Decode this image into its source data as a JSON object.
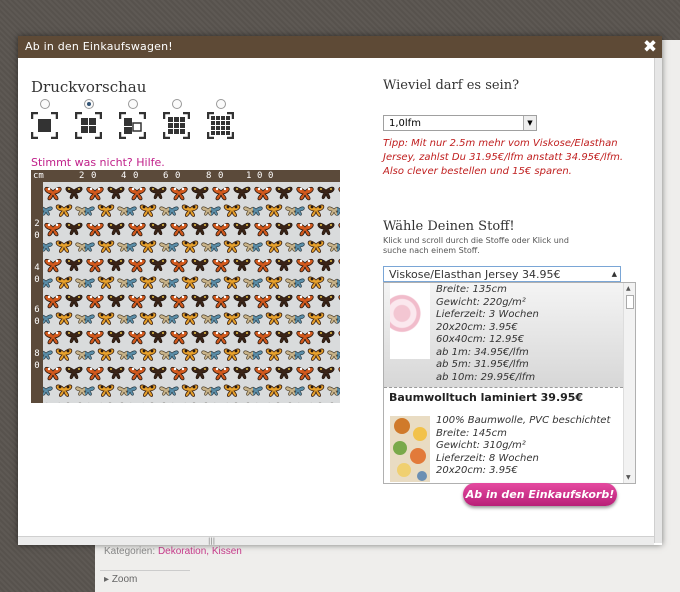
{
  "background": {
    "categories_label": "Kategorien:",
    "categories_links": "Dekoration, Kissen",
    "zoom_label": "Zoom"
  },
  "dialog": {
    "title": "Ab in den Einkaufswagen!",
    "close_icon": "close-icon"
  },
  "preview": {
    "heading": "Druckvorschau",
    "layout_options": [
      "single",
      "2x2",
      "offset",
      "3x3",
      "4x4"
    ],
    "selected_layout_index": 1,
    "help_link": "Stimmt was nicht? Hilfe.",
    "ruler_unit": "cm",
    "ruler_top_labels": [
      "2",
      "0",
      "4",
      "0",
      "6",
      "0",
      "8",
      "0",
      "1",
      "0",
      "0"
    ],
    "ruler_left_labels": [
      "2",
      "0",
      "4",
      "0",
      "6",
      "0",
      "8",
      "0"
    ]
  },
  "quantity": {
    "heading": "Wieviel darf es sein?",
    "selected_value": "1,0lfm",
    "tip": "Tipp: Mit nur 2.5m mehr vom Viskose/Elasthan Jersey, zahlst Du 31.95€/lfm anstatt 34.95€/lfm. Also clever bestellen und 15€ sparen."
  },
  "fabric": {
    "heading": "Wähle Deinen Stoff!",
    "hint": "Klick und scroll durch die Stoffe oder Klick und suche nach einem Stoff.",
    "selected": "Viskose/Elasthan Jersey 34.95€",
    "item1_specs": [
      "Breite: 135cm",
      "Gewicht: 220g/m²",
      "Lieferzeit: 3 Wochen",
      "20x20cm: 3.95€",
      "60x40cm: 12.95€",
      "ab 1m: 34.95€/lfm",
      "ab 5m: 31.95€/lfm",
      "ab 10m: 29.95€/lfm"
    ],
    "item2_title": "Baumwolltuch laminiert 39.95€",
    "item2_specs": [
      "100% Baumwolle, PVC beschichtet",
      "Breite: 145cm",
      "Gewicht: 310g/m²",
      "Lieferzeit: 8 Wochen",
      "20x20cm: 3.95€"
    ]
  },
  "cart_button": "Ab in den Einkaufskorb!",
  "colors": {
    "titlebar": "#5e4a36",
    "accent_pink": "#c0208a",
    "tip_red": "#c02020"
  }
}
